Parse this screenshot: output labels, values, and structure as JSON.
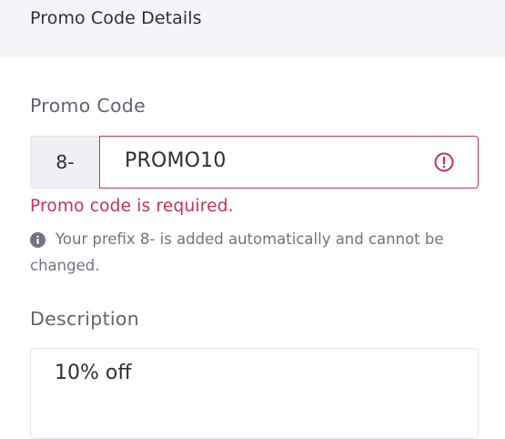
{
  "panel": {
    "title": "Promo Code Details"
  },
  "promo_code": {
    "label": "Promo Code",
    "prefix": "8-",
    "value": "PROMO10",
    "error": "Promo code is required.",
    "hint_line1": "Your prefix 8- is added automatically and cannot be",
    "hint_line2": "changed."
  },
  "description": {
    "label": "Description",
    "value": "10% off"
  },
  "icons": {
    "error": "alert-circle-icon",
    "info": "info-circle-icon"
  },
  "colors": {
    "error": "#c8314f",
    "header_bg": "#f4f5f8",
    "prefix_bg": "#eef0f4"
  }
}
